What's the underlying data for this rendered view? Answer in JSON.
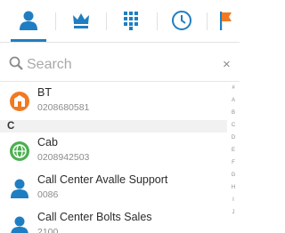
{
  "tabs": [
    {
      "name": "contacts",
      "icon": "person-icon",
      "active": true
    },
    {
      "name": "favorites",
      "icon": "crown-icon",
      "active": false
    },
    {
      "name": "dialpad",
      "icon": "dialpad-icon",
      "active": false
    },
    {
      "name": "recents",
      "icon": "clock-icon",
      "active": false
    },
    {
      "name": "flagged",
      "icon": "flag-icon",
      "active": false
    }
  ],
  "colors": {
    "accent": "#1f7ec2",
    "orange": "#f07a22",
    "green": "#4caf50"
  },
  "search": {
    "placeholder": "Search",
    "value": "",
    "clear_label": "×"
  },
  "section_c": "C",
  "contacts": [
    {
      "name": "BT",
      "number": "0208680581",
      "icon": "building-icon"
    },
    {
      "name": "Cab",
      "number": "0208942503",
      "icon": "globe-icon"
    },
    {
      "name": "Call Center Avalle Support",
      "number": "0086",
      "icon": "person-icon"
    },
    {
      "name": "Call Center Bolts Sales",
      "number": "2100",
      "icon": "person-icon"
    }
  ],
  "index_letters": [
    "#",
    "A",
    "B",
    "C",
    "D",
    "E",
    "F",
    "G",
    "H",
    "I",
    "J"
  ]
}
